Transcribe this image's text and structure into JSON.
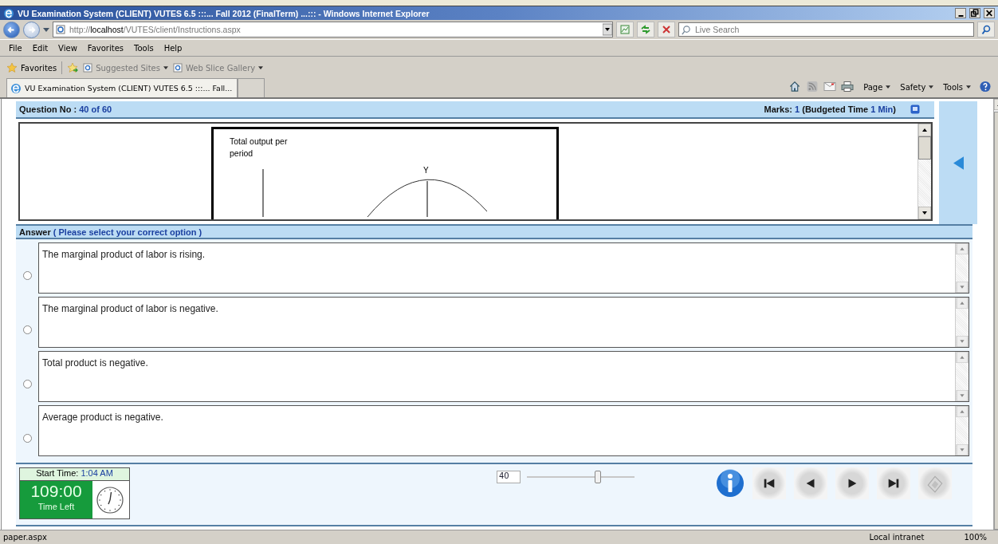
{
  "window": {
    "title": "VU Examination System (CLIENT) VUTES 6.5 :::... Fall 2012 (FinalTerm) ...::: - Windows Internet Explorer"
  },
  "address": {
    "prefix": "http://",
    "host": "localhost",
    "path": "/VUTES/client/Instructions.aspx"
  },
  "search": {
    "placeholder": "Live Search"
  },
  "menu": [
    "File",
    "Edit",
    "View",
    "Favorites",
    "Tools",
    "Help"
  ],
  "favorites_bar": {
    "label": "Favorites",
    "links": [
      "Suggested Sites",
      "Web Slice Gallery"
    ]
  },
  "tabs": [
    {
      "label": "VU Examination System (CLIENT) VUTES 6.5 :::... Fall...",
      "selected": true
    }
  ],
  "command_bar": [
    "Page",
    "Safety",
    "Tools"
  ],
  "question": {
    "label": "Question No :",
    "number": "40 of 60",
    "marks_label": "Marks:",
    "marks": "1",
    "budget_label": "(Budgeted Time",
    "budget": "1 Min",
    "budget_end": ")",
    "figure": {
      "axis_label": "Total output per period",
      "point_label": "Y"
    }
  },
  "answer": {
    "label": "Answer",
    "hint": "( Please select your correct option )"
  },
  "options": [
    {
      "text": "The marginal product of labor is rising.",
      "selected": false
    },
    {
      "text": "The marginal product of labor is negative.",
      "selected": false
    },
    {
      "text": "Total product is negative.",
      "selected": false
    },
    {
      "text": "Average product is negative.",
      "selected": false
    }
  ],
  "timer": {
    "start_label": "Start Time:",
    "start": "1:04 AM",
    "remaining": "109:00",
    "remaining_label": "Time Left"
  },
  "navigator": {
    "value": "40",
    "level": 0.66
  },
  "status_bar": {
    "text": "paper.aspx",
    "zone": "Local intranet",
    "zoom": "100%"
  }
}
